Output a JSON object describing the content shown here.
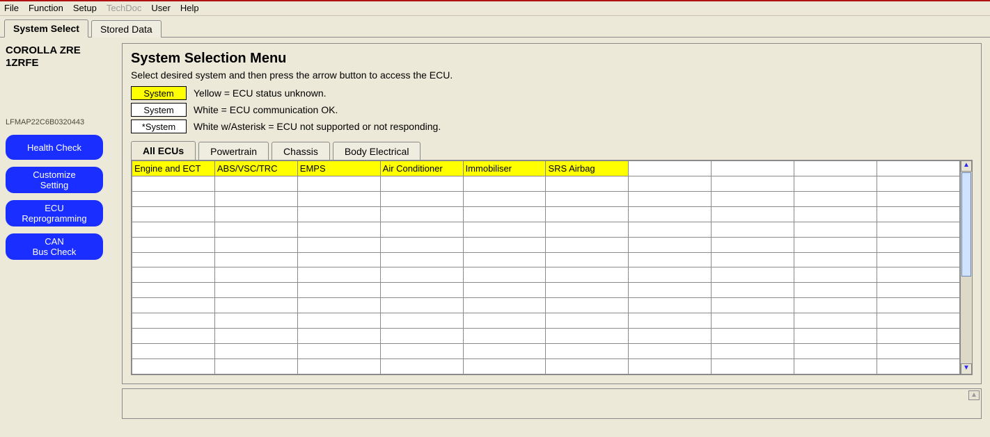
{
  "menu": {
    "file": "File",
    "function": "Function",
    "setup": "Setup",
    "techdoc": "TechDoc",
    "user": "User",
    "help": "Help"
  },
  "top_tabs": {
    "system_select": "System Select",
    "stored_data": "Stored Data"
  },
  "sidebar": {
    "vehicle_line1": "COROLLA ZRE",
    "vehicle_line2": "1ZRFE",
    "vin": "LFMAP22C6B0320443",
    "buttons": {
      "health_check": "Health Check",
      "customize_setting": "Customize\nSetting",
      "ecu_reprogramming": "ECU\nReprogramming",
      "can_bus_check": "CAN\nBus Check"
    }
  },
  "main": {
    "title": "System Selection Menu",
    "subtitle": "Select desired system and then press the arrow button to access the ECU.",
    "legend": {
      "yellow_label": "System",
      "yellow_text": "Yellow = ECU status unknown.",
      "white_label": "System",
      "white_text": "White = ECU communication OK.",
      "asterisk_label": "*System",
      "asterisk_text": "White w/Asterisk = ECU not supported or not responding."
    },
    "ecu_tabs": {
      "all": "All ECUs",
      "powertrain": "Powertrain",
      "chassis": "Chassis",
      "body": "Body Electrical"
    },
    "grid_row1": [
      "Engine and ECT",
      "ABS/VSC/TRC",
      "EMPS",
      "Air Conditioner",
      "Immobiliser",
      "SRS Airbag",
      "",
      "",
      "",
      ""
    ],
    "grid_cols": 10,
    "grid_rows": 14
  }
}
